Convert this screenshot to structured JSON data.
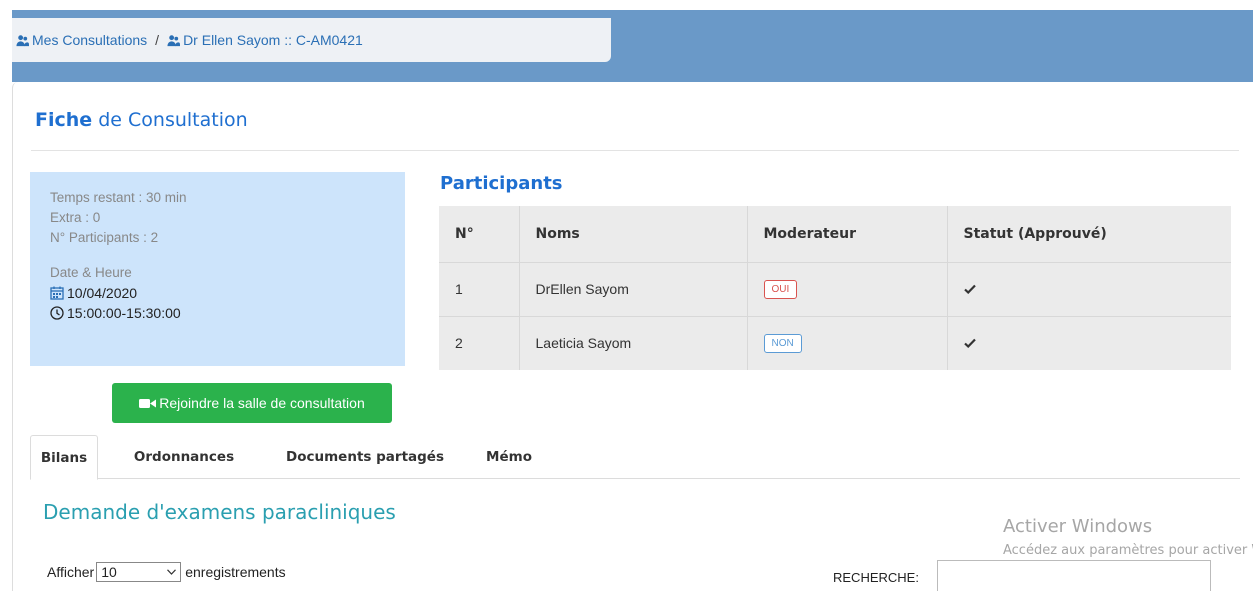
{
  "breadcrumb": {
    "items": [
      {
        "icon": "users-icon",
        "label": "Mes Consultations"
      },
      {
        "icon": "user-doctor-icon",
        "label": "Dr Ellen Sayom :: C-AM0421"
      }
    ],
    "separator": "/"
  },
  "page": {
    "title_bold": "Fiche",
    "title_rest": "de Consultation"
  },
  "info": {
    "temps_restant": "Temps restant : 30 min",
    "extra": "Extra : 0",
    "participants_count": "N° Participants : 2",
    "date_label": "Date & Heure",
    "date": "10/04/2020",
    "time": "15:00:00-15:30:00"
  },
  "join_button": {
    "label": "Rejoindre la salle de consultation",
    "icon": "video-camera-icon"
  },
  "participants": {
    "title": "Participants",
    "columns": [
      "N°",
      "Noms",
      "Moderateur",
      "Statut (Approuvé)"
    ],
    "rows": [
      {
        "num": "1",
        "name": "DrEllen Sayom",
        "moderator": "OUI",
        "status_icon": "check-icon"
      },
      {
        "num": "2",
        "name": "Laeticia Sayom",
        "moderator": "NON",
        "status_icon": "check-icon"
      }
    ]
  },
  "tabs": [
    {
      "label": "Bilans",
      "active": true
    },
    {
      "label": "Ordonnances"
    },
    {
      "label": "Documents partagés"
    },
    {
      "label": "Mémo"
    }
  ],
  "section": {
    "title": "Demande d'examens paracliniques",
    "show_prefix": "Afficher",
    "page_size": "10",
    "show_suffix": "enregistrements",
    "search_label": "RECHERCHE:",
    "search_value": ""
  },
  "watermark": {
    "line1": "Activer Windows",
    "line2": "Accédez aux paramètres pour activer Windows."
  },
  "colors": {
    "accent": "#1f6fd0",
    "header_bar": "#6a99c8",
    "info_bg": "#cde4fb",
    "success": "#2bb24c",
    "danger": "#d9534f",
    "section_title": "#2a9fb0"
  }
}
